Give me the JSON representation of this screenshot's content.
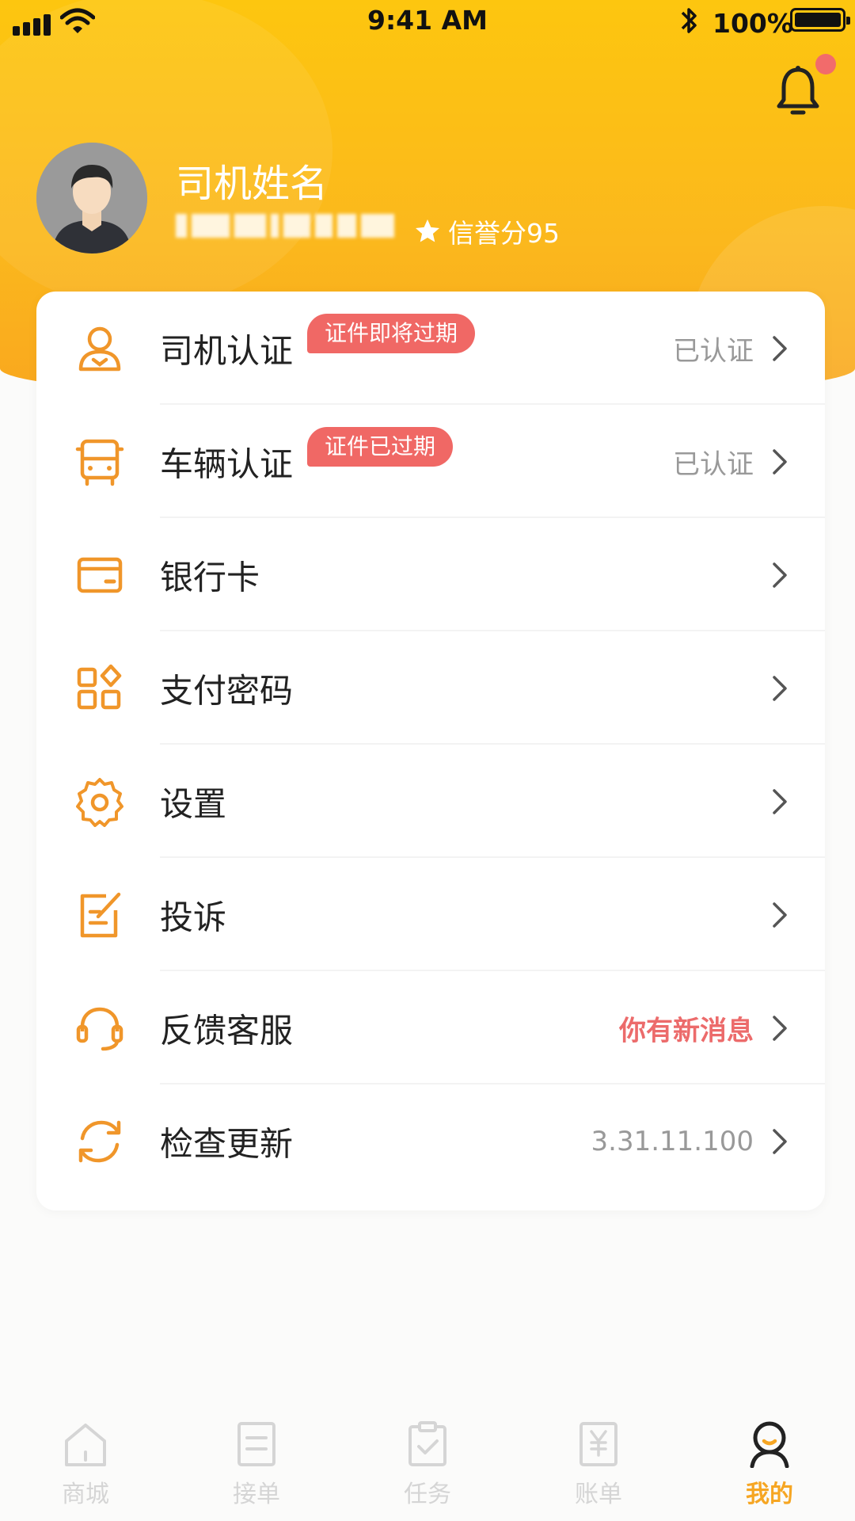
{
  "status_bar": {
    "time": "9:41 AM",
    "battery": "100%"
  },
  "profile": {
    "name": "司机姓名",
    "credit_score": "信誉分95"
  },
  "menu": [
    {
      "label": "司机认证",
      "badge": "证件即将过期",
      "value": "已认证",
      "icon": "driver-person-icon"
    },
    {
      "label": "车辆认证",
      "badge": "证件已过期",
      "value": "已认证",
      "icon": "bus-icon"
    },
    {
      "label": "银行卡",
      "value": "",
      "icon": "bank-card-icon"
    },
    {
      "label": "支付密码",
      "value": "",
      "icon": "grid-apps-icon"
    },
    {
      "label": "设置",
      "value": "",
      "icon": "gear-icon"
    },
    {
      "label": "投诉",
      "value": "",
      "icon": "edit-note-icon"
    },
    {
      "label": "反馈客服",
      "value": "你有新消息",
      "value_color": "#ec6b6b",
      "icon": "headset-icon"
    },
    {
      "label": "检查更新",
      "value": "3.31.11.100",
      "icon": "refresh-icon"
    }
  ],
  "tabs": [
    {
      "label": "商城",
      "icon": "home-icon"
    },
    {
      "label": "接单",
      "icon": "list-icon"
    },
    {
      "label": "任务",
      "icon": "clipboard-check-icon"
    },
    {
      "label": "账单",
      "icon": "yuan-bill-icon"
    },
    {
      "label": "我的",
      "icon": "user-icon",
      "active": true
    }
  ],
  "colors": {
    "accent": "#f6a623",
    "header": "#fdc60f",
    "badge": "#f06865",
    "icon": "#f0962a"
  }
}
